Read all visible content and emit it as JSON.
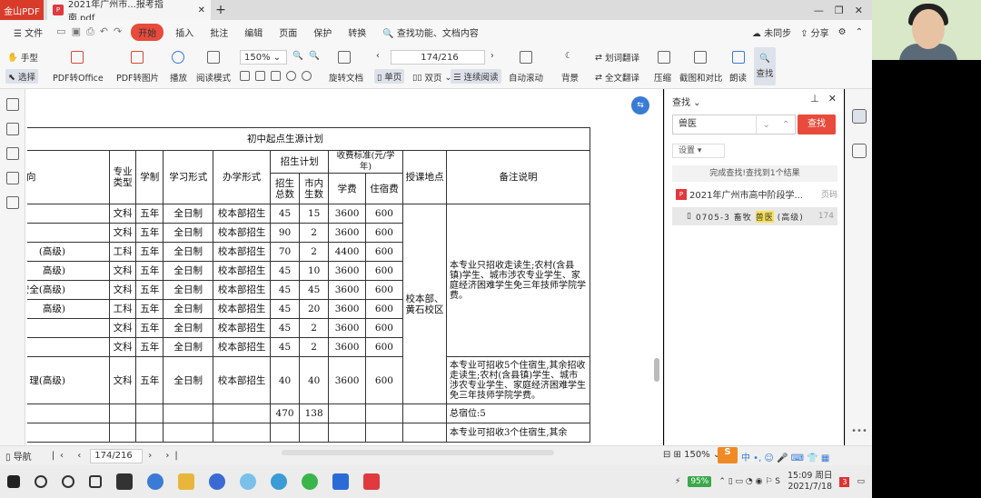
{
  "tabs": {
    "app": "金山PDF",
    "doc": "2021年广州市...报考指南.pdf"
  },
  "menu": {
    "file": "文件",
    "start": "开始",
    "insert": "插入",
    "annotate": "批注",
    "edit": "编辑",
    "page": "页面",
    "protect": "保护",
    "convert": "转换",
    "search_hint": "查找功能、文档内容",
    "unsync": "未同步",
    "share": "分享"
  },
  "toolbar": {
    "hand": "手型",
    "select": "选择",
    "pdf2office": "PDF转Office",
    "pdf2img": "PDF转图片",
    "play": "播放",
    "read_mode": "阅读模式",
    "zoom": "150%",
    "page_input": "174/216",
    "rotate": "旋转文档",
    "single": "单页",
    "double": "双页",
    "continuous": "连续阅读",
    "autoscroll": "自动滚动",
    "bg": "背景",
    "translate_word": "划词翻译",
    "translate_full": "全文翻译",
    "compress": "压缩",
    "screenshot": "截图和对比",
    "read_aloud": "朗读",
    "find": "查找"
  },
  "table": {
    "title": "初中起点生源计划",
    "h_major": "专业与方向",
    "h_type": "专业类型",
    "h_years": "学制",
    "h_form": "学习形式",
    "h_school": "办学形式",
    "h_plan": "招生计划",
    "h_total": "招生总数",
    "h_city": "市内生数",
    "h_fee": "收费标准(元/学年)",
    "h_tuition": "学费",
    "h_dorm": "住宿费",
    "h_loc": "授课地点",
    "h_note": "备注说明",
    "rows": [
      {
        "m": "",
        "t": "文科",
        "y": "五年",
        "f": "全日制",
        "s": "校本部招生",
        "n": "45",
        "c": "15",
        "fee": "3600",
        "d": "600"
      },
      {
        "m": "",
        "t": "文科",
        "y": "五年",
        "f": "全日制",
        "s": "校本部招生",
        "n": "90",
        "c": "2",
        "fee": "3600",
        "d": "600"
      },
      {
        "m": "(高级)",
        "t": "工科",
        "y": "五年",
        "f": "全日制",
        "s": "校本部招生",
        "n": "70",
        "c": "2",
        "fee": "4400",
        "d": "600"
      },
      {
        "m": "高级)",
        "t": "文科",
        "y": "五年",
        "f": "全日制",
        "s": "校本部招生",
        "n": "45",
        "c": "10",
        "fee": "3600",
        "d": "600"
      },
      {
        "m": "质量安全(高级)",
        "t": "文科",
        "y": "五年",
        "f": "全日制",
        "s": "校本部招生",
        "n": "45",
        "c": "45",
        "fee": "3600",
        "d": "600"
      },
      {
        "m": "高级)",
        "t": "工科",
        "y": "五年",
        "f": "全日制",
        "s": "校本部招生",
        "n": "45",
        "c": "20",
        "fee": "3600",
        "d": "600"
      },
      {
        "m": "",
        "t": "文科",
        "y": "五年",
        "f": "全日制",
        "s": "校本部招生",
        "n": "45",
        "c": "2",
        "fee": "3600",
        "d": "600"
      },
      {
        "m": "",
        "t": "文科",
        "y": "五年",
        "f": "全日制",
        "s": "校本部招生",
        "n": "45",
        "c": "2",
        "fee": "3600",
        "d": "600"
      },
      {
        "m": "理(高级)",
        "t": "文科",
        "y": "五年",
        "f": "全日制",
        "s": "校本部招生",
        "n": "40",
        "c": "40",
        "fee": "3600",
        "d": "600"
      }
    ],
    "loc": "校本部、黄石校区",
    "note1": "本专业只招收走读生;农村(含县镇)学生、城市涉农专业学生、家庭经济困难学生免三年技师学院学费。",
    "note2": "本专业可招收5个住宿生,其余招收走读生;农村(含县镇)学生、城市涉农专业学生、家庭经济困难学生免三年技师学院学费。",
    "sum_total": "470",
    "sum_city": "138",
    "sum_note": "总宿位:5",
    "note3": "本专业可招收3个住宿生,其余"
  },
  "find": {
    "title": "查找",
    "query": "兽医",
    "button": "查找",
    "settings": "设置",
    "status": "完成查找!查找到1个结果",
    "file": "2021年广州市高中阶段学...",
    "file_col": "页码",
    "result_pre": "0705-3 畜牧",
    "result_hl": "兽医",
    "result_post": "(高级)",
    "result_page": "174"
  },
  "status": {
    "nav": "导航",
    "page": "174/216",
    "zoom": "150%"
  },
  "taskbar": {
    "battery": "95%",
    "time": "15:09 周日",
    "date": "2021/7/18"
  }
}
